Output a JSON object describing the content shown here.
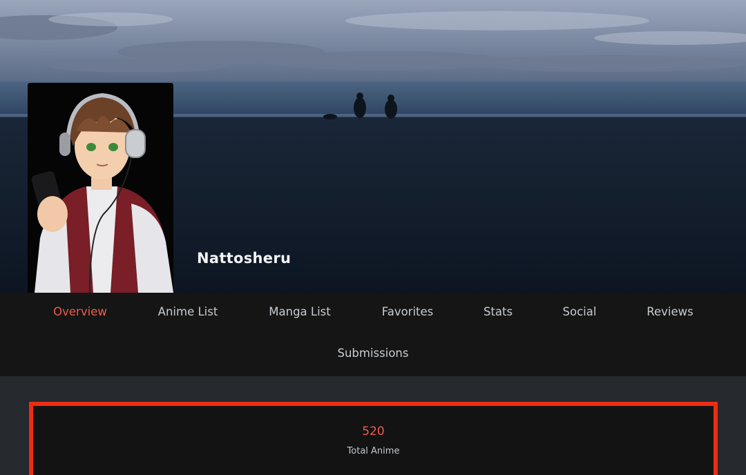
{
  "profile": {
    "username": "Nattosheru"
  },
  "nav": {
    "items": [
      {
        "label": "Overview",
        "active": true
      },
      {
        "label": "Anime List",
        "active": false
      },
      {
        "label": "Manga List",
        "active": false
      },
      {
        "label": "Favorites",
        "active": false
      },
      {
        "label": "Stats",
        "active": false
      },
      {
        "label": "Social",
        "active": false
      },
      {
        "label": "Reviews",
        "active": false
      },
      {
        "label": "Submissions",
        "active": false
      }
    ]
  },
  "stats": {
    "total_anime": {
      "value": "520",
      "label": "Total Anime"
    }
  },
  "colors": {
    "accent": "#ef5b4f",
    "highlight_border": "#ee2c12",
    "nav_background": "#151515",
    "page_background": "#26292d"
  }
}
